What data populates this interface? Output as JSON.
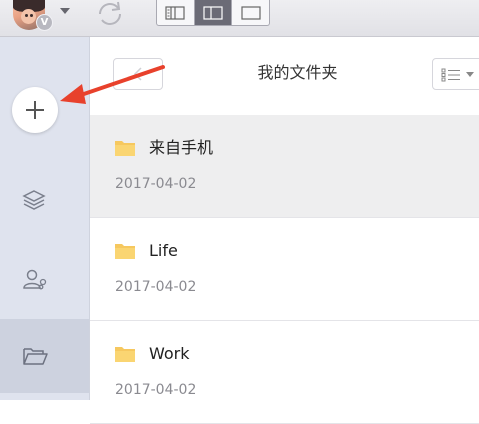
{
  "toolbar": {
    "avatar_icon": "user-avatar",
    "vip_badge": "V",
    "sync_icon": "sync-icon",
    "view_buttons": [
      {
        "icon": "three-column-view-icon",
        "active": false
      },
      {
        "icon": "two-column-view-icon",
        "active": true
      },
      {
        "icon": "single-column-view-icon",
        "active": false
      }
    ]
  },
  "sidebar": {
    "add_icon": "plus-icon",
    "items": [
      {
        "icon": "layers-icon",
        "active": false
      },
      {
        "icon": "shared-users-icon",
        "active": false
      },
      {
        "icon": "folder-open-icon",
        "active": true
      }
    ]
  },
  "main": {
    "title": "我的文件夹",
    "back_icon": "chevron-left-icon",
    "list_mode_icon": "list-view-icon",
    "folders": [
      {
        "name": "来自手机",
        "date": "2017-04-02",
        "selected": true
      },
      {
        "name": "Life",
        "date": "2017-04-02",
        "selected": false
      },
      {
        "name": "Work",
        "date": "2017-04-02",
        "selected": false
      }
    ]
  },
  "colors": {
    "accent_arrow": "#e8412c",
    "folder": "#f6c85f",
    "sidebar_bg": "#dfe3ee",
    "selected_row": "#eeeeef"
  }
}
